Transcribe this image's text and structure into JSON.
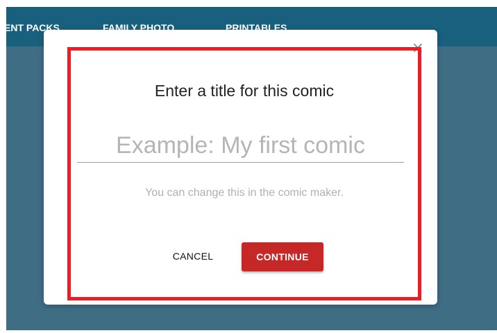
{
  "nav": {
    "items": [
      {
        "label": "ENT PACKS"
      },
      {
        "label": "FAMILY PHOTO"
      },
      {
        "label": "PRINTABLES"
      }
    ]
  },
  "dialog": {
    "close_symbol": "×",
    "title": "Enter a title for this comic",
    "input": {
      "value": "",
      "placeholder": "Example: My first comic"
    },
    "hint": "You can change this in the comic maker.",
    "cancel_label": "CANCEL",
    "continue_label": "CONTINUE"
  },
  "colors": {
    "nav_bg": "#19607e",
    "overlay_bg": "#3f6d84",
    "primary_button": "#c62828",
    "highlight_frame": "#ee1c24"
  }
}
